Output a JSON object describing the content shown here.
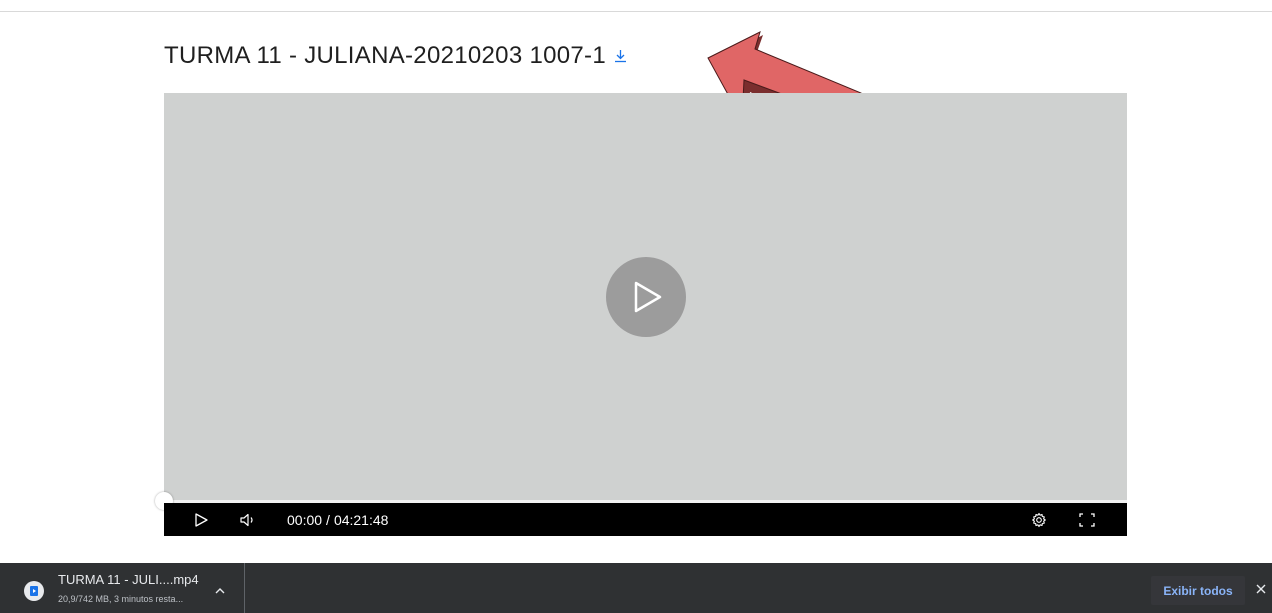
{
  "video": {
    "title": "TURMA 11 - JULIANA-20210203 1007-1",
    "download_icon": "download-arrow-icon",
    "big_play_icon": "play-icon"
  },
  "player": {
    "current_time": "00:00",
    "separator": "/",
    "duration": "04:21:48",
    "progress_fraction": 0,
    "controls": [
      "play-icon",
      "volume-icon",
      "settings-gear-icon",
      "fullscreen-icon"
    ]
  },
  "annotation": {
    "arrow_color": "#e06666",
    "arrow_shadow": "#7a2e2e"
  },
  "download_bar": {
    "file_name": "TURMA 11 - JULI....mp4",
    "status": "20,9/742 MB, 3 minutos resta...",
    "show_all_label": "Exibir todos",
    "file_icon": "video-file-icon",
    "chevron_icon": "chevron-up-icon",
    "close_icon": "close-icon"
  },
  "colors": {
    "accent_blue": "#1a73e8",
    "video_placeholder": "#cfd1d0",
    "download_bar_bg": "#2f3133",
    "show_all_text": "#8ab4f8"
  }
}
